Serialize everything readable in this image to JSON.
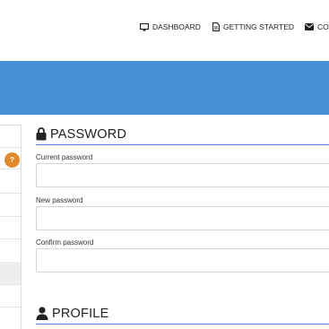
{
  "nav": {
    "dashboard": "DASHBOARD",
    "getting_started": "GETTING STARTED",
    "contact": "CON"
  },
  "colors": {
    "banner": "#4a90d9",
    "accent_line": "#4a90d9",
    "badge": "#e08a2e"
  },
  "sidebar": {
    "badge": "?"
  },
  "password": {
    "title": "PASSWORD",
    "current_label": "Current password",
    "current_value": "",
    "new_label": "New password",
    "new_value": "",
    "confirm_label": "Confirm password",
    "confirm_value": ""
  },
  "profile": {
    "title": "PROFILE"
  }
}
